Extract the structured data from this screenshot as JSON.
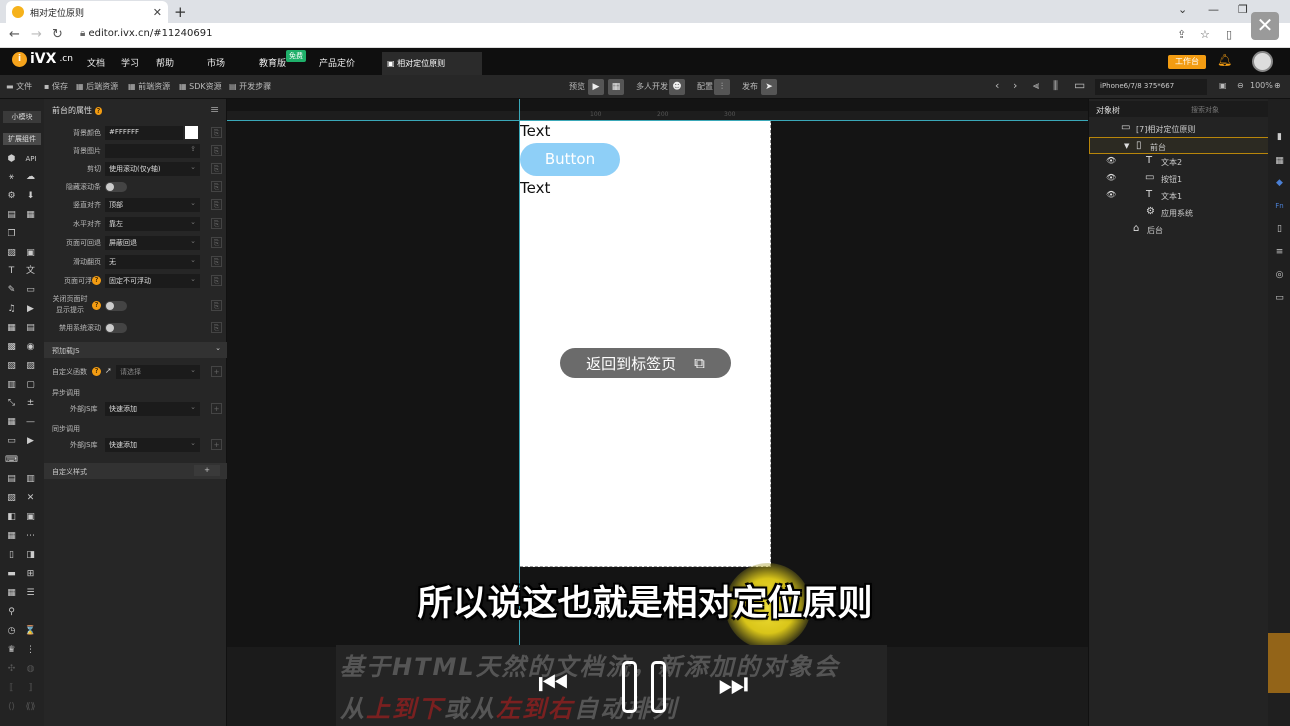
{
  "browser": {
    "tab_title": "相对定位原则",
    "url": "editor.ivx.cn/#11240691"
  },
  "appbar": {
    "logo_main": "iVX",
    "logo_suffix": ".cn",
    "logo_i": "i",
    "menu": [
      "文档",
      "学习",
      "帮助",
      "市场",
      "教育版",
      "产品定价"
    ],
    "badge": "免费",
    "doc_tab": "相对定位原则",
    "workbench": "工作台"
  },
  "toolbar": {
    "left": [
      "文件",
      "保存",
      "后端资源",
      "前端资源",
      "SDK资源",
      "开发步骤"
    ],
    "preview": "预览",
    "multi": "多人开发",
    "config": "配置",
    "publish": "发布",
    "device": "iPhone6/7/8 375*667",
    "zoom": "100%"
  },
  "left_strip": {
    "small_module": "小模块",
    "extend": "扩展组件",
    "api": "API"
  },
  "props": {
    "header": "前台的属性",
    "rows": [
      {
        "label": "背景颜色",
        "value": "#FFFFFF"
      },
      {
        "label": "背景图片",
        "value": ""
      },
      {
        "label": "剪切",
        "value": "使用滚动(仅y轴)"
      },
      {
        "label": "隐藏滚动条",
        "value": ""
      },
      {
        "label": "竖直对齐",
        "value": "顶部"
      },
      {
        "label": "水平对齐",
        "value": "靠左"
      },
      {
        "label": "页面可回退",
        "value": "屏蔽回退"
      },
      {
        "label": "滑动翻页",
        "value": "无"
      },
      {
        "label": "页面可浮动",
        "value": "固定不可浮动"
      },
      {
        "label": "关闭页面时显示提示",
        "value": ""
      },
      {
        "label": "禁用系统滚动",
        "value": ""
      }
    ],
    "section_preload": "预加载JS",
    "custom_func": "自定义函数",
    "select_placeholder": "请选择",
    "async_call": "异步调用",
    "ext_lib": "外部JS库",
    "quick_add": "快速添加",
    "sync_call": "同步调用",
    "custom_style": "自定义样式",
    "plus": "+"
  },
  "canvas": {
    "text1": "Text",
    "button": "Button",
    "text2": "Text",
    "return_label": "返回到标签页",
    "ruler_marks": [
      "100",
      "200",
      "300"
    ]
  },
  "subtitle": "所以说这也就是相对定位原则",
  "banner": {
    "line1": "基于HTML天然的文档流，新添加的对象会",
    "line2_parts": [
      "从",
      "上到下",
      "或从",
      "左到右",
      "自动排列"
    ]
  },
  "object_tree": {
    "tab": "对象树",
    "search_placeholder": "搜索对象",
    "nodes": [
      {
        "label": "[7]相对定位原则"
      },
      {
        "label": "前台"
      },
      {
        "label": "文本2"
      },
      {
        "label": "按钮1"
      },
      {
        "label": "文本1"
      },
      {
        "label": "应用系统"
      },
      {
        "label": "后台"
      }
    ]
  },
  "colors": {
    "accent": "#f39c12",
    "guide": "#3aa8b8",
    "button": "#8ecff7"
  }
}
